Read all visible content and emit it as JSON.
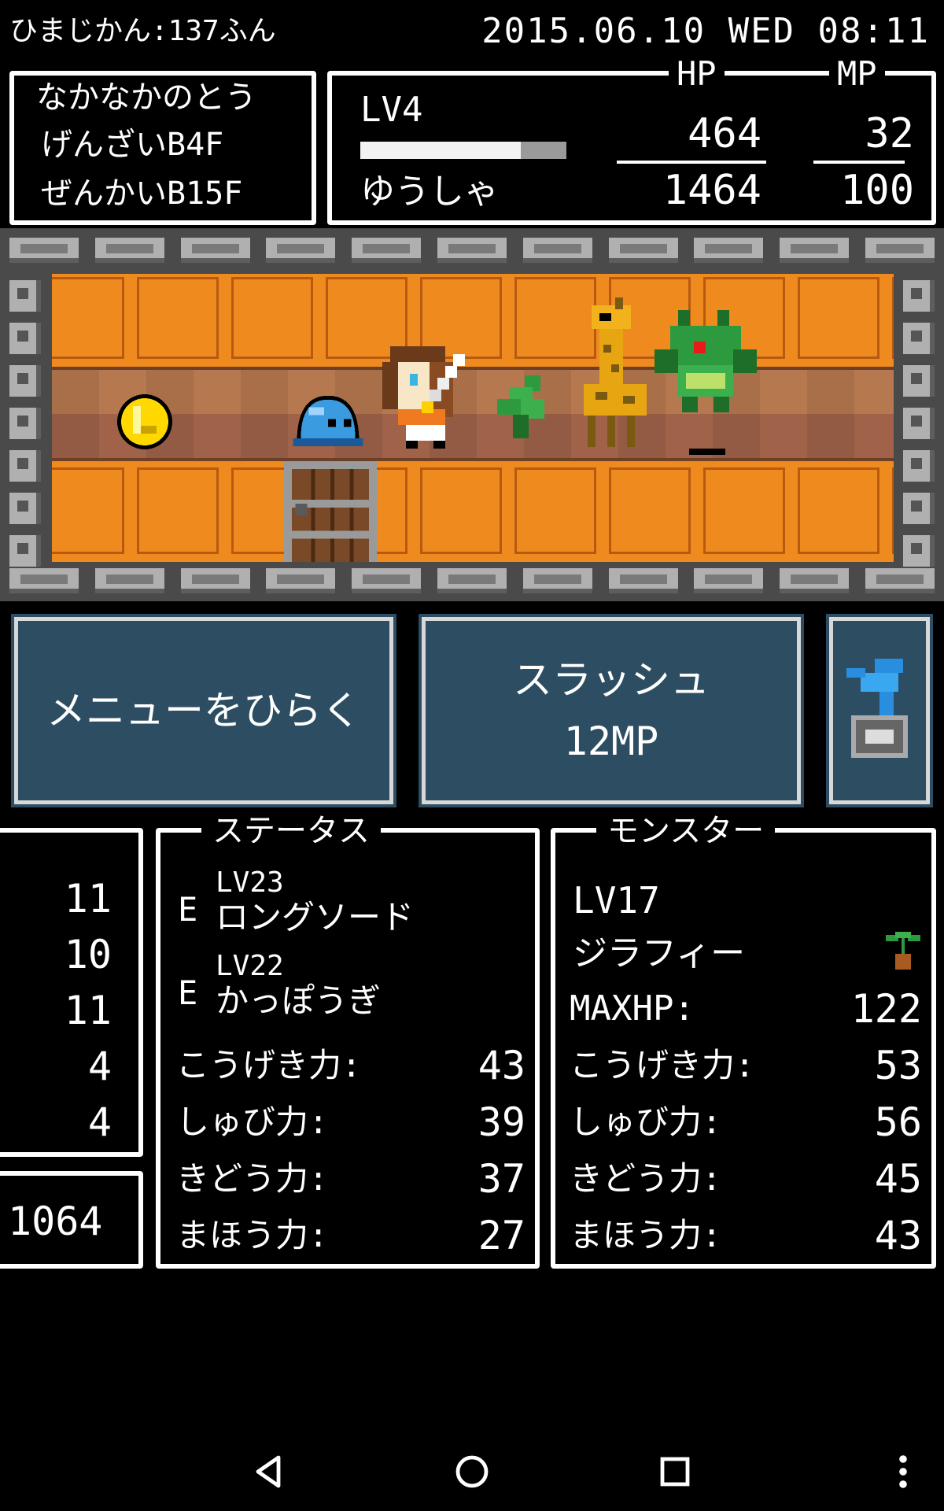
{
  "top": {
    "playtime": "ひまじかん:137ふん",
    "datetime": "2015.06.10 WED 08:11"
  },
  "location": {
    "tower": "なかなかのとう",
    "current_floor": "げんざいB4F",
    "deepest_floor": "ぜんかいB15F"
  },
  "player": {
    "level": "LV4",
    "name": "ゆうしゃ",
    "exp_fraction": 0.78,
    "hp_label": "HP",
    "mp_label": "MP",
    "hp_current": "464",
    "hp_max": "1464",
    "mp_current": "32",
    "mp_max": "100"
  },
  "buttons": {
    "menu_label": "メニューをひらく",
    "skill_name": "スラッシュ",
    "skill_cost": "12MP",
    "item_icon": "blue-bird-cage-icon"
  },
  "left_stats": {
    "values": [
      "11",
      "10",
      "11",
      "4",
      "4"
    ],
    "gold": "1064"
  },
  "status": {
    "title": "ステータス",
    "equipment": [
      {
        "marker": "E",
        "level": "LV23",
        "name": "ロングソード"
      },
      {
        "marker": "E",
        "level": "LV22",
        "name": "かっぽうぎ"
      }
    ],
    "stats": [
      {
        "label": "こうげき力:",
        "value": "43"
      },
      {
        "label": "しゅび力:",
        "value": "39"
      },
      {
        "label": "きどう力:",
        "value": "37"
      },
      {
        "label": "まほう力:",
        "value": "27"
      }
    ]
  },
  "monster": {
    "title": "モンスター",
    "level": "LV17",
    "name": "ジラフィー",
    "maxhp_label": "MAXHP:",
    "maxhp": "122",
    "stats": [
      {
        "label": "こうげき力:",
        "value": "53"
      },
      {
        "label": "しゅび力:",
        "value": "56"
      },
      {
        "label": "きどう力:",
        "value": "45"
      },
      {
        "label": "まほう力:",
        "value": "43"
      }
    ]
  },
  "colors": {
    "button_bg": "#2d4e62",
    "floor_orange": "#ef8b1e",
    "floor_brown": "#a86a47",
    "wall_gray": "#b0b0b0"
  },
  "nav": {
    "back_icon": "back-triangle-icon",
    "home_icon": "home-circle-icon",
    "recents_icon": "recents-square-icon",
    "more_icon": "more-vertical-icon"
  }
}
